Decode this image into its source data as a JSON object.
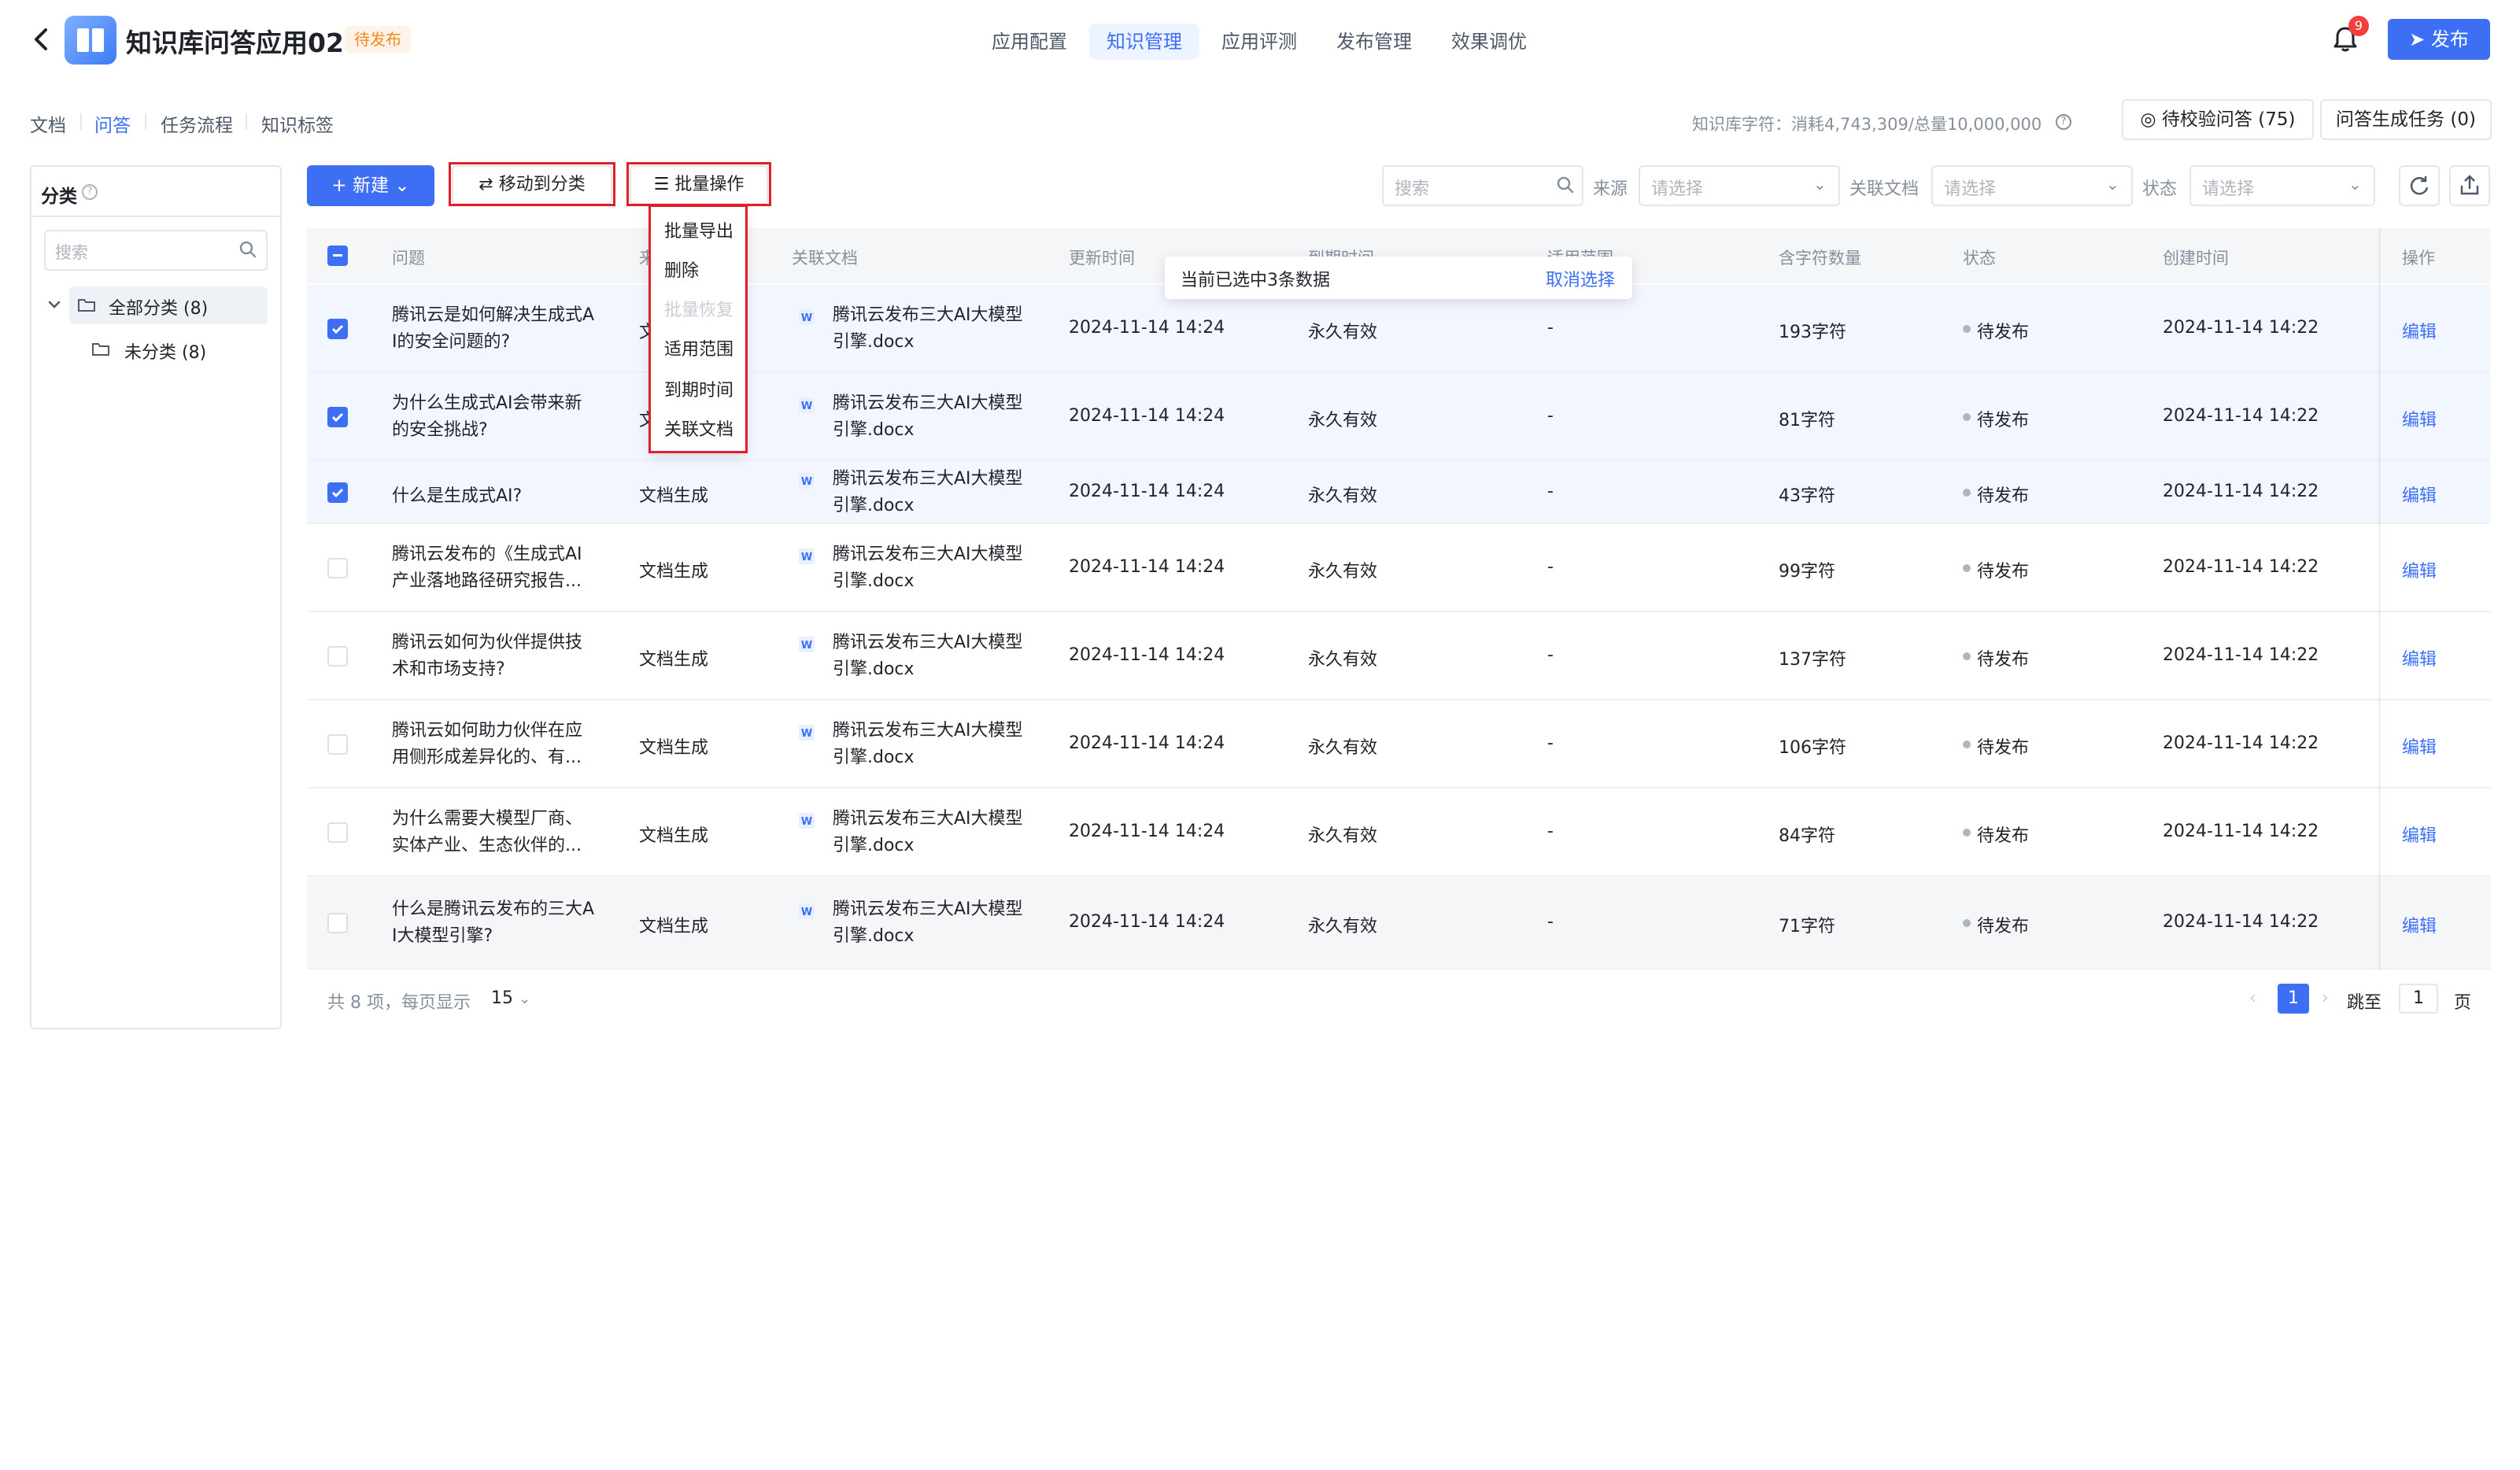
{
  "header": {
    "title": "知识库问答应用02",
    "badge": "待发布",
    "tabs": [
      "应用配置",
      "知识管理",
      "应用评测",
      "发布管理",
      "效果调优"
    ],
    "active_tab": "知识管理",
    "notification_count": "9",
    "publish_label": "发布",
    "accent_color": "#3d6ff5"
  },
  "subtabs": [
    "文档",
    "问答",
    "任务流程",
    "知识标签"
  ],
  "active_subtab": "问答",
  "quota": {
    "text": "知识库字符：消耗4,743,309/总量10,000,000"
  },
  "right_buttons": {
    "pending_qa": "待校验问答 (75)",
    "gen_task": "问答生成任务 (0)"
  },
  "left_panel": {
    "title": "分类",
    "search_placeholder": "搜索",
    "tree": [
      {
        "label": "全部分类",
        "count": "(8)"
      },
      {
        "label": "未分类",
        "count": "(8)"
      }
    ]
  },
  "toolbar": {
    "new_label": "新建",
    "move_label": "移动到分类",
    "batch_label": "批量操作",
    "search_placeholder": "搜索",
    "source_label": "来源",
    "doc_label": "关联文档",
    "status_label": "状态",
    "select_placeholder": "请选择"
  },
  "batch_menu": {
    "items": [
      "批量导出",
      "删除",
      "批量恢复",
      "适用范围",
      "到期时间",
      "关联文档"
    ],
    "disabled": [
      "批量恢复"
    ]
  },
  "selection": {
    "text": "当前已选中3条数据",
    "cancel": "取消选择"
  },
  "table": {
    "headers": [
      "问题",
      "来源",
      "关联文档",
      "更新时间",
      "到期时间",
      "适用范围",
      "含字符数量",
      "状态",
      "创建时间",
      "操作"
    ],
    "rows": [
      {
        "q1": "腾讯云是如何解决生成式A",
        "q2": "I的安全问题的?",
        "source": "文",
        "doc1": "腾讯云发布三大AI大模型",
        "doc2": "引擎.docx",
        "updated": "2024-11-14 14:24",
        "expire": "永久有效",
        "scope": "-",
        "chars": "193字符",
        "status": "待发布",
        "created": "2024-11-14 14:22",
        "op": "编辑",
        "checked": true
      },
      {
        "q1": "为什么生成式AI会带来新",
        "q2": "的安全挑战?",
        "source": "文",
        "doc1": "腾讯云发布三大AI大模型",
        "doc2": "引擎.docx",
        "updated": "2024-11-14 14:24",
        "expire": "永久有效",
        "scope": "-",
        "chars": "81字符",
        "status": "待发布",
        "created": "2024-11-14 14:22",
        "op": "编辑",
        "checked": true
      },
      {
        "q1": "什么是生成式AI?",
        "q2": "",
        "source": "文档生成",
        "doc1": "腾讯云发布三大AI大模型",
        "doc2": "引擎.docx",
        "updated": "2024-11-14 14:24",
        "expire": "永久有效",
        "scope": "-",
        "chars": "43字符",
        "status": "待发布",
        "created": "2024-11-14 14:22",
        "op": "编辑",
        "checked": true
      },
      {
        "q1": "腾讯云发布的《生成式AI",
        "q2": "产业落地路径研究报告...",
        "source": "文档生成",
        "doc1": "腾讯云发布三大AI大模型",
        "doc2": "引擎.docx",
        "updated": "2024-11-14 14:24",
        "expire": "永久有效",
        "scope": "-",
        "chars": "99字符",
        "status": "待发布",
        "created": "2024-11-14 14:22",
        "op": "编辑",
        "checked": false
      },
      {
        "q1": "腾讯云如何为伙伴提供技",
        "q2": "术和市场支持?",
        "source": "文档生成",
        "doc1": "腾讯云发布三大AI大模型",
        "doc2": "引擎.docx",
        "updated": "2024-11-14 14:24",
        "expire": "永久有效",
        "scope": "-",
        "chars": "137字符",
        "status": "待发布",
        "created": "2024-11-14 14:22",
        "op": "编辑",
        "checked": false
      },
      {
        "q1": "腾讯云如何助力伙伴在应",
        "q2": "用侧形成差异化的、有...",
        "source": "文档生成",
        "doc1": "腾讯云发布三大AI大模型",
        "doc2": "引擎.docx",
        "updated": "2024-11-14 14:24",
        "expire": "永久有效",
        "scope": "-",
        "chars": "106字符",
        "status": "待发布",
        "created": "2024-11-14 14:22",
        "op": "编辑",
        "checked": false
      },
      {
        "q1": "为什么需要大模型厂商、",
        "q2": "实体产业、生态伙伴的...",
        "source": "文档生成",
        "doc1": "腾讯云发布三大AI大模型",
        "doc2": "引擎.docx",
        "updated": "2024-11-14 14:24",
        "expire": "永久有效",
        "scope": "-",
        "chars": "84字符",
        "status": "待发布",
        "created": "2024-11-14 14:22",
        "op": "编辑",
        "checked": false
      },
      {
        "q1": "什么是腾讯云发布的三大A",
        "q2": "I大模型引擎?",
        "source": "文档生成",
        "doc1": "腾讯云发布三大AI大模型",
        "doc2": "引擎.docx",
        "updated": "2024-11-14 14:24",
        "expire": "永久有效",
        "scope": "-",
        "chars": "71字符",
        "status": "待发布",
        "created": "2024-11-14 14:22",
        "op": "编辑",
        "checked": false
      }
    ]
  },
  "pagination": {
    "summary": "共 8 项，每页显示",
    "page_size": "15",
    "current": "1",
    "jump_label": "跳至",
    "jump_value": "1",
    "page_unit": "页"
  }
}
